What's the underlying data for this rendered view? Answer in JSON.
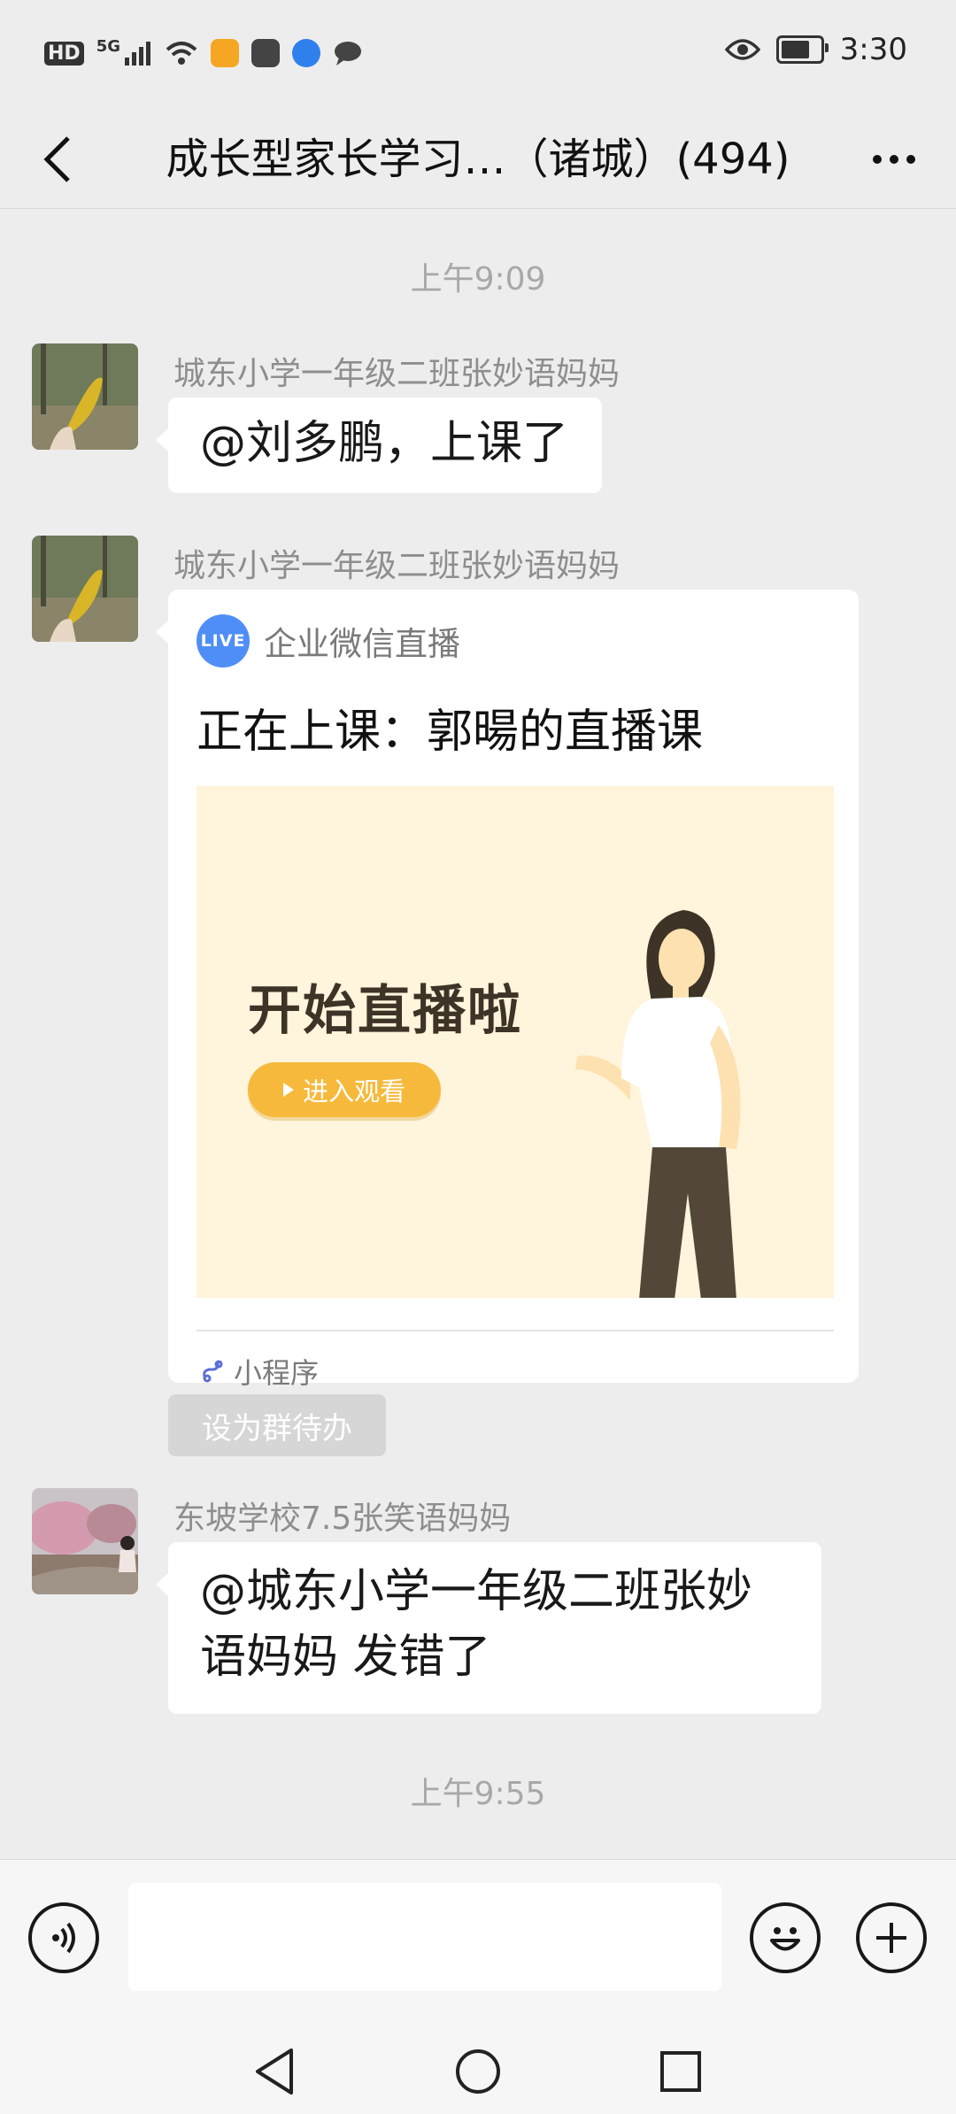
{
  "status_bar": {
    "network_hd": "HD",
    "network_gen": "5G",
    "time": "3:30",
    "battery_level": 0.75
  },
  "nav": {
    "title": "成长型家长学习…（诸城）(494)"
  },
  "messages": [
    {
      "type": "time",
      "text": "上午9:09"
    },
    {
      "type": "text",
      "sender": "城东小学一年级二班张妙语妈妈",
      "text": "@刘多鹏，上课了"
    },
    {
      "type": "mini_program",
      "sender": "城东小学一年级二班张妙语妈妈",
      "badge": "LIVE",
      "source": "企业微信直播",
      "title": "正在上课：郭暘的直播课",
      "image_headline": "开始直播啦",
      "image_button": "进入观看",
      "footer": "小程序"
    },
    {
      "type": "action",
      "label": "设为群待办"
    },
    {
      "type": "text",
      "sender": "东坡学校7.5张笑语妈妈",
      "text_line1": "@城东小学一年级二班张妙",
      "text_line2": "语妈妈  发错了"
    },
    {
      "type": "time",
      "text": "上午9:55"
    }
  ],
  "input": {
    "value": "",
    "placeholder": ""
  },
  "icons": {
    "back": "back-arrow-icon",
    "more": "more-dots-icon",
    "voice": "voice-icon",
    "emoji": "emoji-icon",
    "plus": "plus-icon",
    "mini_program": "mini-program-link-icon",
    "sys_back": "triangle-back-icon",
    "sys_home": "circle-home-icon",
    "sys_recents": "square-recents-icon"
  },
  "colors": {
    "background": "#ededed",
    "bubble": "#ffffff",
    "live_badge": "#4f8ef7",
    "card_image_bg": "#fff4dc",
    "image_button": "#f6b93b"
  }
}
